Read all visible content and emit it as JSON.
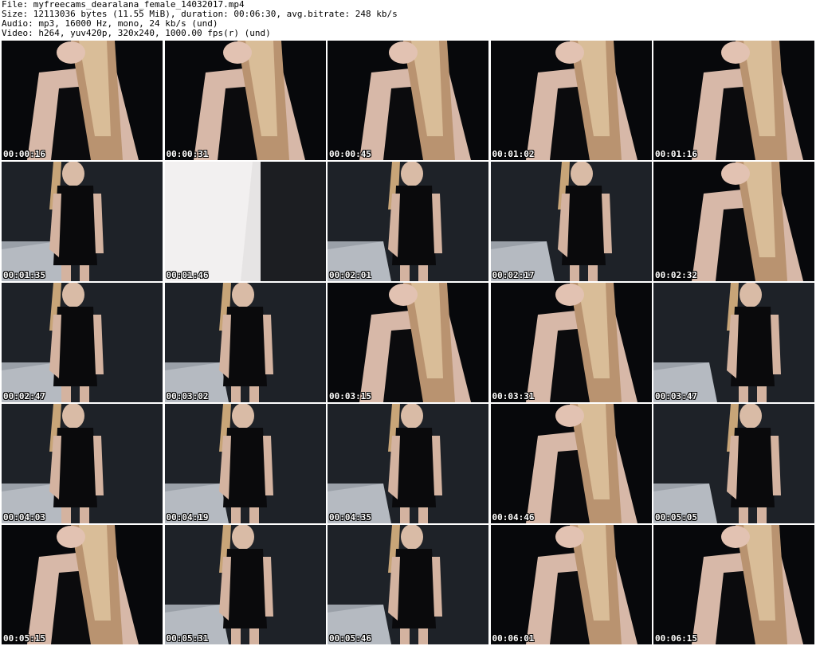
{
  "header": {
    "file_line": "File: myfreecams_dearalana_female_14032017.mp4",
    "size_line": "Size: 12113036 bytes (11.55 MiB), duration: 00:06:30, avg.bitrate: 248 kb/s",
    "audio_line": "Audio: mp3, 16000 Hz, mono, 24 kb/s (und)",
    "video_line": "Video: h264, yuv420p, 320x240, 1000.00 fps(r) (und)"
  },
  "thumbnails": [
    {
      "time": "00:00:16",
      "scene": "closeup"
    },
    {
      "time": "00:00:31",
      "scene": "closeup"
    },
    {
      "time": "00:00:45",
      "scene": "closeup"
    },
    {
      "time": "00:01:02",
      "scene": "closeup"
    },
    {
      "time": "00:01:16",
      "scene": "closeup"
    },
    {
      "time": "00:01:35",
      "scene": "room"
    },
    {
      "time": "00:01:46",
      "scene": "bright"
    },
    {
      "time": "00:02:01",
      "scene": "room"
    },
    {
      "time": "00:02:17",
      "scene": "room"
    },
    {
      "time": "00:02:32",
      "scene": "closeup"
    },
    {
      "time": "00:02:47",
      "scene": "room"
    },
    {
      "time": "00:03:02",
      "scene": "room"
    },
    {
      "time": "00:03:15",
      "scene": "closeup"
    },
    {
      "time": "00:03:31",
      "scene": "closeup"
    },
    {
      "time": "00:03:47",
      "scene": "room"
    },
    {
      "time": "00:04:03",
      "scene": "room"
    },
    {
      "time": "00:04:19",
      "scene": "room"
    },
    {
      "time": "00:04:35",
      "scene": "room"
    },
    {
      "time": "00:04:46",
      "scene": "closeup"
    },
    {
      "time": "00:05:05",
      "scene": "room"
    },
    {
      "time": "00:05:15",
      "scene": "closeup"
    },
    {
      "time": "00:05:31",
      "scene": "room"
    },
    {
      "time": "00:05:46",
      "scene": "room"
    },
    {
      "time": "00:06:01",
      "scene": "closeup"
    },
    {
      "time": "00:06:15",
      "scene": "closeup"
    }
  ]
}
